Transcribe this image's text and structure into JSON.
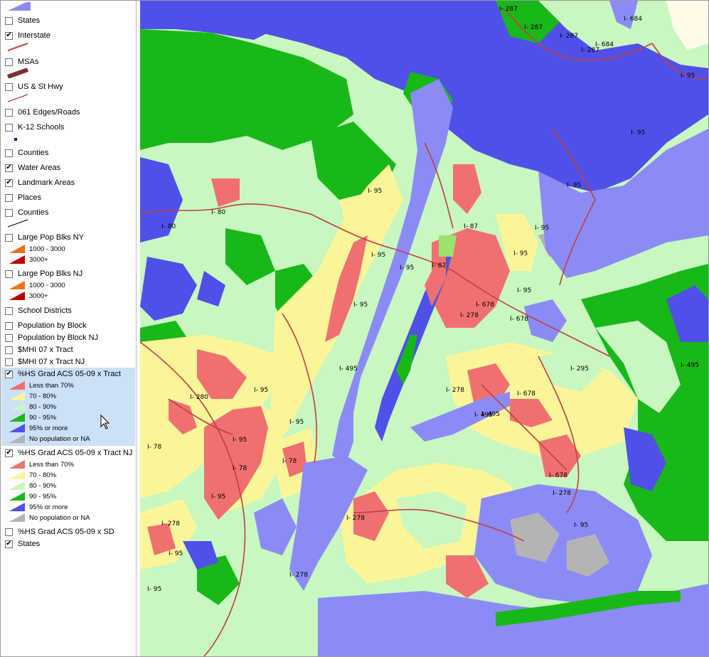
{
  "legend": {
    "layers": [
      {
        "label": "States",
        "checked": false
      },
      {
        "label": "Interstate",
        "checked": true
      },
      {
        "label": "MSAs",
        "checked": false
      },
      {
        "label": "US & St Hwy",
        "checked": false
      },
      {
        "label": "061 Edges/Roads",
        "checked": false
      },
      {
        "label": "K-12 Schools",
        "checked": false
      },
      {
        "label": "Counties",
        "checked": false
      },
      {
        "label": "Water Areas",
        "checked": true
      },
      {
        "label": "Landmark Areas",
        "checked": true
      },
      {
        "label": "Places",
        "checked": false
      },
      {
        "label": "Counties",
        "checked": false
      },
      {
        "label": "Large Pop Blks NY",
        "checked": false
      },
      {
        "label": "Large Pop Blks NJ",
        "checked": false
      },
      {
        "label": "School Districts",
        "checked": false
      },
      {
        "label": "Population by Block",
        "checked": false
      },
      {
        "label": "Population by Block NJ",
        "checked": false
      },
      {
        "label": "$MHI 07 x Tract",
        "checked": false
      },
      {
        "label": "$MHI 07 x Tract NJ",
        "checked": false
      },
      {
        "label": "%HS Grad ACS 05-09 x Tract",
        "checked": true
      },
      {
        "label": "%HS Grad ACS 05-09 x Tract NJ",
        "checked": true
      },
      {
        "label": "%HS Grad ACS 05-09 x SD",
        "checked": false
      },
      {
        "label": "States",
        "checked": true
      }
    ],
    "pop_blks_ny": [
      "1000 - 3000",
      "3000+"
    ],
    "pop_blks_nj": [
      "1000 - 3000",
      "3000+"
    ],
    "hs_grad_tract": [
      "Less than 70%",
      "70 - 80%",
      "80 - 90%",
      "90 - 95%",
      "95% or more",
      "No population or NA"
    ],
    "hs_grad_tract_nj": [
      "Less than 70%",
      "70 - 80%",
      "80 - 90%",
      "90 - 95%",
      "95% or more",
      "No population or NA"
    ]
  },
  "colors": {
    "less70": "#f07070",
    "p70_80": "#fbf59a",
    "p80_90": "#c8f7c0",
    "p90_95": "#18b818",
    "p95": "#5050e8",
    "na": "#b4b4b4",
    "water": "#8b8bf7",
    "interstate": "#c04040"
  },
  "map": {
    "interstate_labels": [
      "I- 287",
      "I- 287",
      "I- 287",
      "I- 287",
      "I- 684",
      "I- 684",
      "I- 95",
      "I- 95",
      "I- 95",
      "I- 80",
      "I- 80",
      "I- 95",
      "I- 95",
      "I- 87",
      "I- 95",
      "I- 95",
      "I- 95",
      "I- 87",
      "I- 278",
      "I- 678",
      "I- 95",
      "I- 295",
      "I- 495",
      "I- 495",
      "I- 495",
      "I- 280",
      "I- 95",
      "I- 95",
      "I- 95",
      "I- 78",
      "I- 78",
      "I- 78",
      "I- 95",
      "I- 278",
      "I- 278",
      "I- 678",
      "I- 278",
      "I- 278",
      "I- 495",
      "I- 678",
      "I- 678",
      "I- 95",
      "I- 95",
      "I- 278",
      "I- 95",
      "I- 95"
    ]
  }
}
